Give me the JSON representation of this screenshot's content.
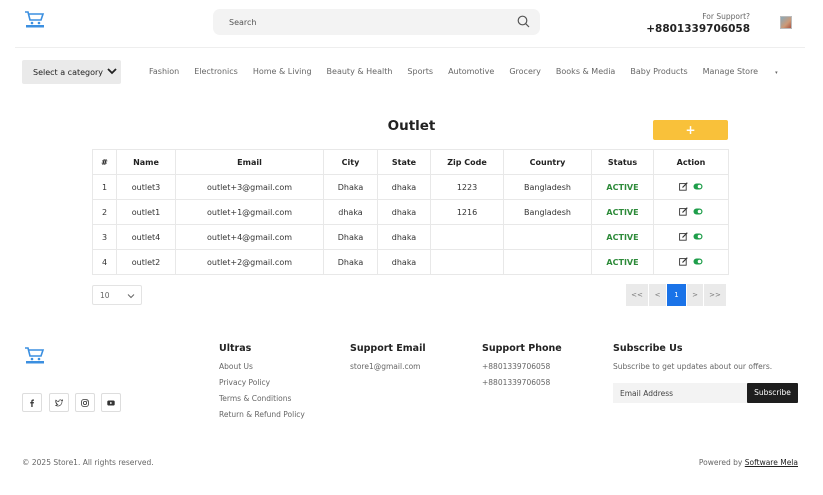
{
  "header": {
    "search_placeholder": "Search",
    "support_label": "For Support?",
    "support_phone": "+8801339706058",
    "logo_icon": "cart-logo-icon"
  },
  "nav": {
    "category_select": "Select a category",
    "links": [
      "Fashion",
      "Electronics",
      "Home & Living",
      "Beauty & Health",
      "Sports",
      "Automotive",
      "Grocery",
      "Books & Media",
      "Baby Products",
      "Manage Store"
    ],
    "manage_caret": "▾"
  },
  "main": {
    "title": "Outlet",
    "add_label": "+",
    "columns": [
      "#",
      "Name",
      "Email",
      "City",
      "State",
      "Zip Code",
      "Country",
      "Status",
      "Action"
    ],
    "rows": [
      {
        "n": "1",
        "name": "outlet3",
        "email": "outlet+3@gmail.com",
        "city": "Dhaka",
        "state": "dhaka",
        "zip": "1223",
        "country": "Bangladesh",
        "status": "ACTIVE"
      },
      {
        "n": "2",
        "name": "outlet1",
        "email": "outlet+1@gmail.com",
        "city": "dhaka",
        "state": "dhaka",
        "zip": "1216",
        "country": "Bangladesh",
        "status": "ACTIVE"
      },
      {
        "n": "3",
        "name": "outlet4",
        "email": "outlet+4@gmail.com",
        "city": "Dhaka",
        "state": "dhaka",
        "zip": "",
        "country": "",
        "status": "ACTIVE"
      },
      {
        "n": "4",
        "name": "outlet2",
        "email": "outlet+2@gmail.com",
        "city": "Dhaka",
        "state": "dhaka",
        "zip": "",
        "country": "",
        "status": "ACTIVE"
      }
    ],
    "page_size": "10",
    "pager": [
      "<<",
      "<",
      "1",
      ">",
      ">>"
    ],
    "status_color": "#2e8b3a",
    "accent": "#f9c13a"
  },
  "footer": {
    "social_icons": [
      "facebook-icon",
      "twitter-icon",
      "instagram-icon",
      "youtube-icon"
    ],
    "ultras_title": "Ultras",
    "ultras_links": [
      "About Us",
      "Privacy Policy",
      "Terms & Conditions",
      "Return & Refund Policy"
    ],
    "email_title": "Support Email",
    "email_value": "store1@gmail.com",
    "phone_title": "Support Phone",
    "phones": [
      "+8801339706058",
      "+8801339706058"
    ],
    "subscribe_title": "Subscribe Us",
    "subscribe_text": "Subscribe to get updates about our offers.",
    "email_placeholder": "Email Address",
    "subscribe_button": "Subscribe",
    "copyright": "© 2025 Store1. All rights reserved.",
    "powered_by": "Powered by",
    "powered_link": "Software Mela"
  }
}
